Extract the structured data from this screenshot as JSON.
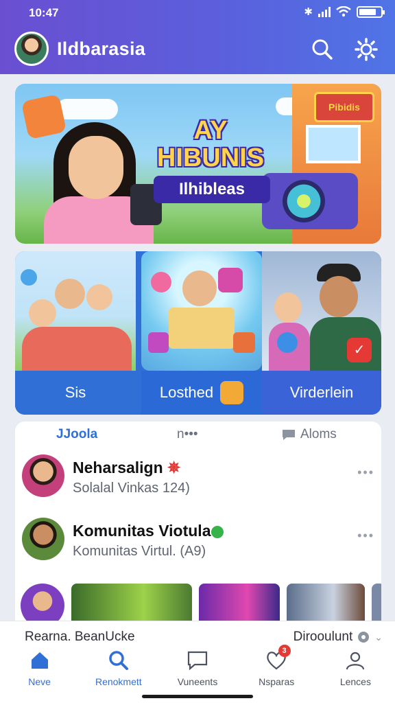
{
  "status_bar": {
    "time": "10:47"
  },
  "header": {
    "title": "Ildbarasia",
    "search_icon": "search-icon",
    "settings_icon": "gear-icon"
  },
  "hero": {
    "title": "AY HIBUNIS",
    "subtitle": "Ilhibleas",
    "sign": "Pibidis"
  },
  "categories": [
    {
      "label": "Sis"
    },
    {
      "label": "Losthed"
    },
    {
      "label": "Virderlein"
    }
  ],
  "tabs": {
    "first": "JJoola",
    "second": "n•••",
    "third": "Aloms"
  },
  "rows": [
    {
      "name": "Neharsalign",
      "sub": "Solalal Vinkas 124)",
      "more": "•••"
    },
    {
      "name": "Komunitas Viotula",
      "sub": "Komunitas Virtul. (A9)",
      "more": "•••"
    }
  ],
  "bottom_strip": {
    "left": "Rearna. BeanUcke",
    "right": "Dirooulunt"
  },
  "nav": [
    {
      "label": "Neve",
      "icon": "home-icon"
    },
    {
      "label": "Renokmett",
      "icon": "search-icon"
    },
    {
      "label": "Vuneents",
      "icon": "chat-icon"
    },
    {
      "label": "Nsparas",
      "icon": "heart-icon",
      "badge": "3"
    },
    {
      "label": "Lences",
      "icon": "person-icon"
    }
  ],
  "colors": {
    "accent": "#2f6fd6",
    "header_start": "#6a4fd1",
    "header_end": "#4f74e6",
    "badge": "#e53935"
  }
}
